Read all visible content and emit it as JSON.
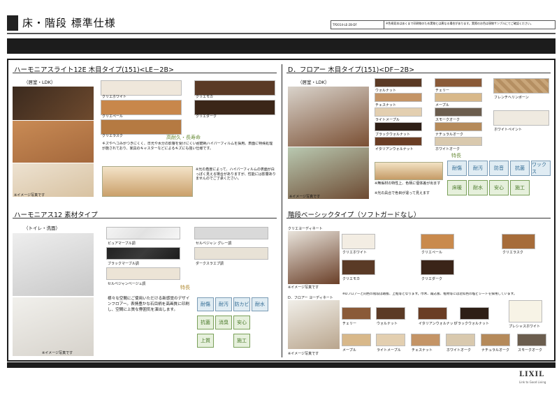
{
  "header": {
    "title": "床・階段 標準仕様",
    "note_code": "TP2014-LE-2B-DF",
    "note_text": "※色柄見本はあくまで印刷物のため実物とは異なる場合があります。実際のお色は現物サンプルにてご確認ください。"
  },
  "sections": {
    "s1": {
      "title": "ハーモニアスライト12E 木目タイプ(151)<LE－2B>",
      "room": "（居室・LDK）",
      "swatches": [
        "クリエホワイト",
        "クリエモカ",
        "クリエペール",
        "クリエダーク",
        "クリエラスク"
      ],
      "feature_title": "高耐久・長寿命",
      "feature_text": "キズやヘコみがつきにくく、日光や水分の影響を受けにくい耐磨耗ハイパーフィルムを採用。表面に特殊処理が施されており、家具のキャスターなどによるキズにも強い仕様です。",
      "note_text": "※光の角度によって、ハイパーフィルムの表面が白っぽく見える場合がありますが、性能には影響ありませんのでご了承ください。",
      "image_note": "※イメージ写真です"
    },
    "s2": {
      "title": "D．フロアー 木目タイプ(151)<DF－2B>",
      "room": "（居室・LDK）",
      "swatches": [
        "ウォルナット",
        "チェリー",
        "チェスナット",
        "メープル",
        "ライトメープル",
        "スモークオーク",
        "ブラックウォルナット",
        "ナチュラルオーク",
        "イタリアンウォルナット",
        "ホワイトオーク",
        "フレンチヘリンボーン",
        "ホワイトペイント"
      ],
      "swatch_notes": [
        "※無垢材の特性上、色柄に個体差が出ます",
        "※光の具合で色目が違って見えます"
      ],
      "feature_title": "特長",
      "icons": [
        "耐傷",
        "耐汚",
        "防音",
        "抗菌",
        "ワックス",
        "床暖",
        "耐水",
        "安心",
        "施工"
      ],
      "image_note": "※イメージ写真です"
    },
    "s3": {
      "title": "ハーモニアス12 素材タイプ",
      "room": "（トイレ・洗面）",
      "swatches": [
        "ピュアマーブル調",
        "セルベジャン グレー調",
        "ブラックマーブル調",
        "ダークスラエプ調",
        "セルベジャンベージュ調"
      ],
      "feature_title": "特長",
      "feature_text": "様々な空間にご使用いただける新感覚のデザインフロアー。表情豊かな石目柄を高画質に印刷し、空間に上質な雰囲気を演出します。",
      "icons": [
        "耐傷",
        "耐汚",
        "防カビ",
        "耐水",
        "抗菌",
        "消臭",
        "安心",
        "上質",
        "施工"
      ],
      "image_note": "※イメージ写真です"
    },
    "s4": {
      "title": "階段ベーシックタイプ（ソフトガードなし）",
      "sub1": "クリエヨーディネート",
      "swatches1": [
        "クリエホワイト",
        "クリエペール",
        "クリエラスク",
        "クリエモカ",
        "クリエダーク"
      ],
      "sub2": "D．フロアー ヨーディネート",
      "sub2_note": "※Dフロアーと同色の階段は踏板、上框等となります。巾木、蹴込板、框材等には近似色の塩ビシートを採用しています。",
      "swatches2": [
        "チェリー",
        "ウォルナット",
        "イタリアンウォルナット",
        "ブラックウォルナット",
        "プレシャスホワイト",
        "メープル",
        "ライトメープル",
        "チェスナット",
        "ホワイトオーク",
        "ナチュラルオーク",
        "スモークオーク"
      ],
      "image_note": "※イメージ写真です"
    }
  },
  "footer": {
    "brand": "LIXIL",
    "tagline": "Link to Good Living"
  },
  "colors": {
    "bar": "#1c1c1c",
    "feature_green": "#6a8c3a",
    "feature_gold": "#b08a30"
  }
}
